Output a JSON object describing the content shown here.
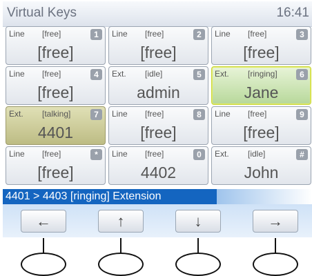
{
  "header": {
    "title": "Virtual Keys",
    "time": "16:41"
  },
  "keys": [
    {
      "type": "Line",
      "state": "[free]",
      "badge": "1",
      "main": "[free]",
      "style": "normal"
    },
    {
      "type": "Line",
      "state": "[free]",
      "badge": "2",
      "main": "[free]",
      "style": "normal"
    },
    {
      "type": "Line",
      "state": "[free]",
      "badge": "3",
      "main": "[free]",
      "style": "normal"
    },
    {
      "type": "Line",
      "state": "[free]",
      "badge": "4",
      "main": "[free]",
      "style": "normal"
    },
    {
      "type": "Ext.",
      "state": "[idle]",
      "badge": "5",
      "main": "admin",
      "style": "normal"
    },
    {
      "type": "Ext.",
      "state": "[ringing]",
      "badge": "6",
      "main": "Jane",
      "style": "ringing"
    },
    {
      "type": "Ext.",
      "state": "[talking]",
      "badge": "7",
      "main": "4401",
      "style": "talking"
    },
    {
      "type": "Line",
      "state": "[free]",
      "badge": "8",
      "main": "[free]",
      "style": "normal"
    },
    {
      "type": "Line",
      "state": "[free]",
      "badge": "9",
      "main": "[free]",
      "style": "normal"
    },
    {
      "type": "Line",
      "state": "[free]",
      "badge": "*",
      "main": "[free]",
      "style": "normal"
    },
    {
      "type": "Line",
      "state": "[free]",
      "badge": "0",
      "main": "4402",
      "style": "normal"
    },
    {
      "type": "Ext.",
      "state": "[idle]",
      "badge": "#",
      "main": "John",
      "style": "normal"
    }
  ],
  "status": {
    "text": "4401 > 4403 [ringing] Extension"
  },
  "softkeys": [
    {
      "icon": "arrow-left-icon",
      "glyph": "←"
    },
    {
      "icon": "arrow-up-icon",
      "glyph": "↑"
    },
    {
      "icon": "arrow-down-icon",
      "glyph": "↓"
    },
    {
      "icon": "arrow-right-icon",
      "glyph": "→"
    }
  ],
  "colors": {
    "status_bar": "#1465c0",
    "ringing": "#b7d89a",
    "talking": "#bdbc84"
  }
}
